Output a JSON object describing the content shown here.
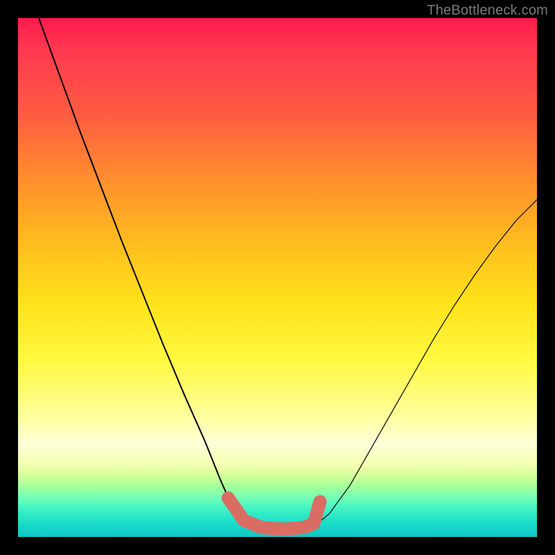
{
  "watermark": "TheBottleneck.com",
  "colors": {
    "background": "#000000",
    "curve": "#000000",
    "highlight": "#d96d63"
  },
  "chart_data": {
    "type": "line",
    "title": "",
    "xlabel": "",
    "ylabel": "",
    "xlim": [
      0,
      100
    ],
    "ylim": [
      0,
      100
    ],
    "series": [
      {
        "name": "left-curve",
        "x": [
          4,
          8,
          12,
          16,
          20,
          24,
          28,
          32,
          36,
          39,
          41,
          43,
          45
        ],
        "y": [
          100,
          89,
          78,
          67.5,
          57,
          47,
          37,
          27.5,
          18.5,
          11,
          6.5,
          3.5,
          2
        ]
      },
      {
        "name": "bottom-flat",
        "x": [
          45,
          48,
          51,
          54,
          57
        ],
        "y": [
          2,
          1.5,
          1.3,
          1.5,
          2
        ]
      },
      {
        "name": "right-curve",
        "x": [
          57,
          60,
          64,
          68,
          72,
          76,
          80,
          84,
          88,
          92,
          96,
          100
        ],
        "y": [
          2,
          4.5,
          10,
          17,
          24,
          31,
          38,
          44.5,
          50.5,
          56,
          61,
          65
        ]
      },
      {
        "name": "highlight-segment",
        "x": [
          40.5,
          43.5,
          47,
          51,
          55,
          57,
          58.2
        ],
        "y": [
          7.5,
          3.2,
          1.8,
          1.5,
          1.8,
          2.6,
          6.8
        ]
      }
    ],
    "gradient_stops": [
      {
        "pos": 0,
        "color": "#ff1a4d"
      },
      {
        "pos": 50,
        "color": "#ffe21a"
      },
      {
        "pos": 82,
        "color": "#ffffd8"
      },
      {
        "pos": 100,
        "color": "#10c7c4"
      }
    ]
  }
}
